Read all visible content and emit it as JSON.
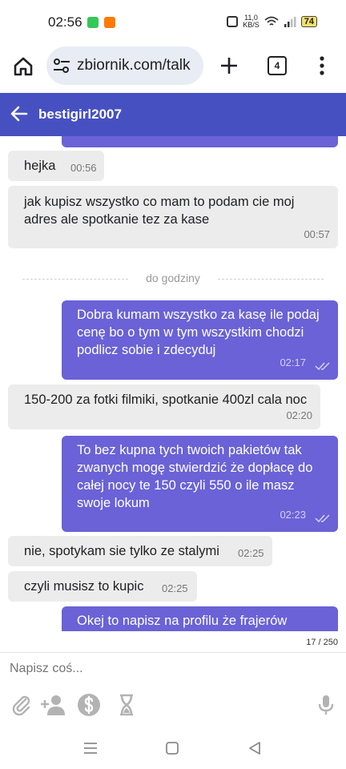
{
  "status_bar": {
    "time": "02:56",
    "speed_top": "11,0",
    "speed_bottom": "KB/S",
    "battery": "74"
  },
  "browser": {
    "url": "zbiornik.com/talk",
    "tab_count": "4"
  },
  "chat": {
    "title": "bestigirl2007"
  },
  "messages": [
    {
      "dir": "in",
      "text": "hejka",
      "time": "00:56"
    },
    {
      "dir": "in",
      "text": "jak kupisz wszystko co mam to podam cie moj adres ale spotkanie tez za kase",
      "time": "00:57"
    },
    {
      "dir": "out",
      "text": "Dobra kumam wszystko za kasę ile podaj cenę bo o tym w tym wszystkim chodzi podlicz sobie i zdecyduj",
      "time": "02:17"
    },
    {
      "dir": "in",
      "text": "150-200 za fotki filmiki, spotkanie 400zl cala noc",
      "time": "02:20"
    },
    {
      "dir": "out",
      "text": "To bez kupna tych twoich pakietów tak zwanych mogę stwierdzić że dopłacę do całej nocy te 150 czyli 550 o ile masz swoje lokum",
      "time": "02:23"
    },
    {
      "dir": "in",
      "text": "nie, spotykam sie tylko ze stalymi",
      "time": "02:25"
    },
    {
      "dir": "in",
      "text": "czyli musisz to kupic",
      "time": "02:25"
    },
    {
      "dir": "out",
      "text": "Okej to napisz na profilu że frajerów"
    }
  ],
  "divider_label": "do godziny",
  "composer": {
    "placeholder": "Napisz coś...",
    "counter": "17 / 250"
  },
  "colors": {
    "header": "#4750c0",
    "outgoing": "#6a62d6",
    "incoming": "#ececec"
  }
}
